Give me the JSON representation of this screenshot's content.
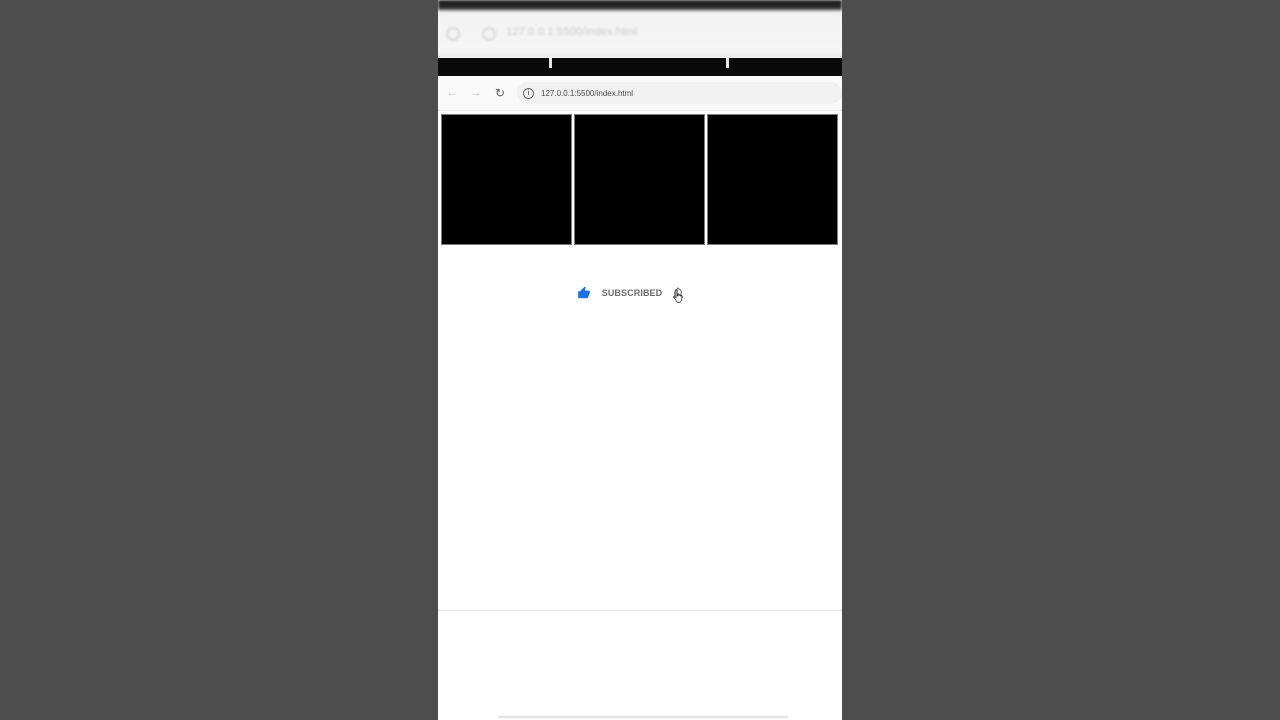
{
  "ghost_bar": {
    "url_text": "127.0.0.1:5500/index.html"
  },
  "browser": {
    "back_glyph": "←",
    "forward_glyph": "→",
    "reload_glyph": "↻",
    "info_glyph": "i",
    "url": "127.0.0.1:5500/index.html"
  },
  "tiles": [
    {
      "color": "#000000"
    },
    {
      "color": "#000000"
    },
    {
      "color": "#000000"
    }
  ],
  "actions": {
    "like_icon": "thumbs-up-icon",
    "like_color": "#1a73e8",
    "subscribe_label": "SUBSCRIBED",
    "bell_icon": "bell-icon"
  },
  "colors": {
    "page_bg": "#4d4d4d",
    "phone_bg": "#ffffff",
    "accent": "#1a73e8"
  }
}
